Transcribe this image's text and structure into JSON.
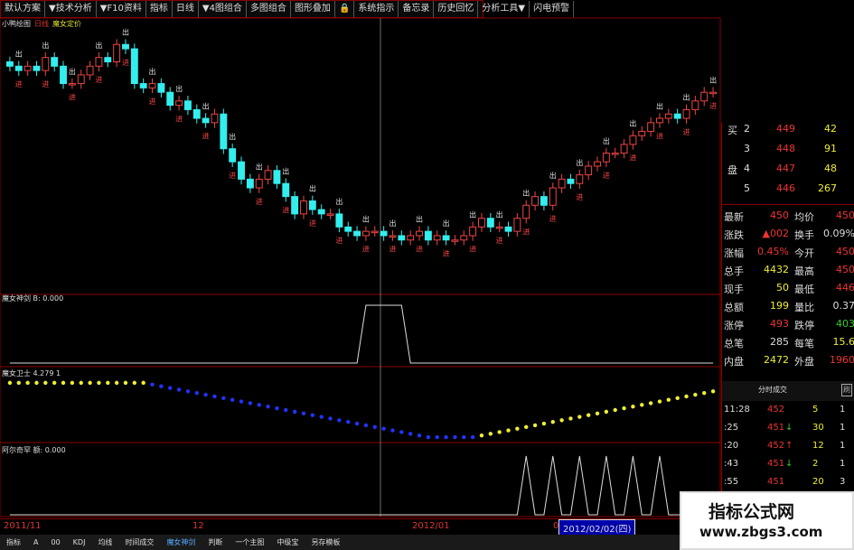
{
  "menu": [
    "默认方案",
    "▼技术分析",
    "▼F10资料",
    "指标",
    "日线",
    "▼4图组合",
    "多图组合",
    "图形叠加",
    "🔒",
    "系统指示",
    "备忘录",
    "历史回忆",
    "分析工具▼",
    "闪电预警"
  ],
  "subtitle": {
    "a": "小鸭绘图",
    "b": "日线",
    "c": "魔女定价"
  },
  "panels": {
    "p2": "魔女神剑 B: 0.000",
    "p3": "魔女卫士 4.279 1",
    "p4": "阿尔奇罕 额: 0.000"
  },
  "chart_labels": {
    "sell": "出",
    "buy": "进"
  },
  "chart_data": {
    "type": "candlestick",
    "series": [
      {
        "values": [
          456,
          455,
          456,
          455,
          458,
          456,
          452,
          452,
          454,
          456,
          458,
          457,
          461,
          460,
          452,
          451,
          452,
          450,
          447,
          448,
          446,
          444,
          443,
          445,
          437,
          434,
          430,
          428,
          430,
          432,
          429,
          426,
          422,
          425,
          423,
          422,
          422,
          419,
          418,
          417,
          418,
          418,
          417,
          417,
          416,
          417,
          418,
          416,
          417,
          416,
          416,
          417,
          419,
          421,
          419,
          419,
          418,
          421,
          424,
          426,
          424,
          428,
          430,
          429,
          431,
          433,
          434,
          436,
          436,
          438,
          440,
          441,
          443,
          444,
          445,
          444,
          446,
          448,
          450,
          450
        ]
      },
      {
        "values": [
          0,
          0,
          0,
          0,
          0,
          0,
          0,
          0,
          0,
          0,
          0,
          0,
          0,
          0,
          0,
          0,
          0,
          0,
          0,
          0,
          0,
          0,
          0,
          0,
          0,
          0,
          0,
          0,
          0,
          0,
          0,
          0,
          0,
          0,
          0,
          0,
          0,
          0,
          0,
          0,
          1,
          1,
          1,
          1,
          1,
          0,
          0,
          0,
          0,
          0,
          0,
          0,
          0,
          0,
          0,
          0,
          0,
          0,
          0,
          0,
          0,
          0,
          0,
          0,
          0,
          0,
          0,
          0,
          0,
          0,
          0,
          0,
          0,
          0,
          0,
          0,
          0,
          0,
          0,
          0
        ]
      },
      {
        "values": [
          4.2,
          4.2,
          4.2,
          4.2,
          4.2,
          4.2,
          4.2,
          4.2,
          4.2,
          4.2,
          4.2,
          4.2,
          4.2,
          4.2,
          4.2,
          4.2,
          4.1,
          4.0,
          3.9,
          3.8,
          3.7,
          3.6,
          3.5,
          3.4,
          3.3,
          3.2,
          3.1,
          3.0,
          2.9,
          2.8,
          2.7,
          2.6,
          2.5,
          2.4,
          2.3,
          2.2,
          2.1,
          2.0,
          1.9,
          1.8,
          1.7,
          1.6,
          1.5,
          1.4,
          1.3,
          1.2,
          1.1,
          1.0,
          1.0,
          1.0,
          1.0,
          1.0,
          1.0,
          1.1,
          1.2,
          1.3,
          1.4,
          1.5,
          1.6,
          1.7,
          1.8,
          1.9,
          2.0,
          2.1,
          2.2,
          2.3,
          2.4,
          2.5,
          2.6,
          2.7,
          2.8,
          2.9,
          3.0,
          3.1,
          3.2,
          3.3,
          3.4,
          3.5,
          3.6,
          3.7
        ]
      },
      {
        "values": [
          0,
          0,
          0,
          0,
          0,
          0,
          0,
          0,
          0,
          0,
          0,
          0,
          0,
          0,
          0,
          0,
          0,
          0,
          0,
          0,
          0,
          0,
          0,
          0,
          0,
          0,
          0,
          0,
          0,
          0,
          0,
          0,
          0,
          0,
          0,
          0,
          0,
          0,
          0,
          0,
          0,
          0,
          0,
          0,
          0,
          0,
          0,
          0,
          0,
          0,
          0,
          0,
          0,
          0,
          0,
          0,
          0,
          0,
          1,
          0,
          0,
          1,
          0,
          0,
          1,
          0,
          0,
          1,
          0,
          0,
          1,
          0,
          0,
          1,
          0,
          0,
          0,
          0,
          0,
          0
        ]
      }
    ],
    "x_ticks": [
      "2011/11",
      "12",
      "2012/01",
      "02"
    ],
    "selected_date": "2012/02/02(四)"
  },
  "orderbook": [
    {
      "side": "买",
      "level": "2",
      "price": "449",
      "vol": "42"
    },
    {
      "side": "",
      "level": "3",
      "price": "448",
      "vol": "91"
    },
    {
      "side": "盘",
      "level": "4",
      "price": "447",
      "vol": "48"
    },
    {
      "side": "",
      "level": "5",
      "price": "446",
      "vol": "267"
    }
  ],
  "quote": [
    {
      "k1": "最新",
      "v1": "450",
      "k2": "均价",
      "v2": "450"
    },
    {
      "k1": "涨跌",
      "v1": "▲002",
      "k2": "换手",
      "v2": "0.09%"
    },
    {
      "k1": "涨幅",
      "v1": "0.45%",
      "k2": "今开",
      "v2": "450"
    },
    {
      "k1": "总手",
      "v1": "4432",
      "k2": "最高",
      "v2": "450"
    },
    {
      "k1": "现手",
      "v1": "50",
      "k2": "最低",
      "v2": "446"
    },
    {
      "k1": "总额",
      "v1": "199",
      "k2": "量比",
      "v2": "0.37"
    },
    {
      "k1": "涨停",
      "v1": "493",
      "k2": "跌停",
      "v2": "403"
    },
    {
      "k1": "总笔",
      "v1": "285",
      "k2": "每笔",
      "v2": "15.6"
    },
    {
      "k1": "内盘",
      "v1": "2472",
      "k2": "外盘",
      "v2": "1960"
    }
  ],
  "ticks_title": "分时成交",
  "ticks_btn": "刷",
  "ticks": [
    {
      "time": "11:28",
      "price": "452",
      "arrow": "",
      "vol": "5",
      "c": "1"
    },
    {
      "time": ":25",
      "price": "451",
      "arrow": "↓",
      "vol": "30",
      "c": "1"
    },
    {
      "time": ":20",
      "price": "452",
      "arrow": "↑",
      "vol": "12",
      "c": "1"
    },
    {
      "time": ":43",
      "price": "451",
      "arrow": "↓",
      "vol": "2",
      "c": "1"
    },
    {
      "time": ":55",
      "price": "451",
      "arrow": "",
      "vol": "20",
      "c": "3"
    }
  ],
  "statusbar": [
    "指标",
    "A",
    "00",
    "KDJ",
    "均线",
    "时间成交",
    "魔女神剑",
    "判断",
    "一个主图",
    "中级宝",
    "另存模板"
  ],
  "watermark": {
    "line1": "指标公式网",
    "line2": "www.zbgs3.com"
  }
}
